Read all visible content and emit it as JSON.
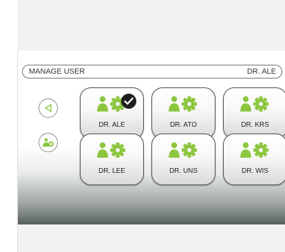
{
  "header": {
    "title": "MANAGE USER",
    "current_user": "DR. ALE"
  },
  "sidebar": {
    "back_icon": "triangle-left-icon",
    "add_icon": "add-user-icon"
  },
  "users": [
    {
      "label": "DR. ALE",
      "selected": true
    },
    {
      "label": "DR. ATO",
      "selected": false
    },
    {
      "label": "DR. KRS",
      "selected": false
    },
    {
      "label": "DR. LEE",
      "selected": false
    },
    {
      "label": "DR. UNS",
      "selected": false
    },
    {
      "label": "DR. WIS",
      "selected": false
    }
  ],
  "colors": {
    "accent": "#8cc63f",
    "outline": "#4a4a4a",
    "check_bg": "#1f1f1f"
  }
}
